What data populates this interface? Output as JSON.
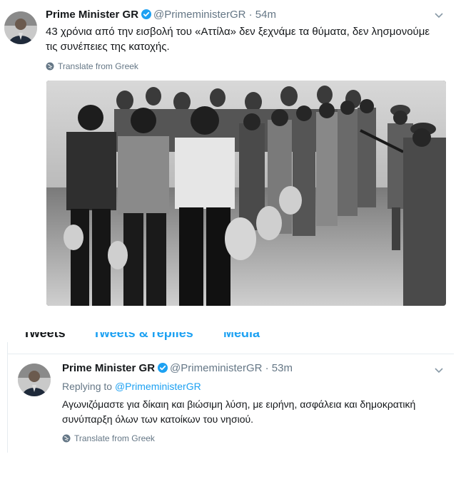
{
  "tweet1": {
    "author_name": "Prime Minister GR",
    "handle": "@PrimeministerGR",
    "separator": "·",
    "time": "54m",
    "text_line1": "43 χρόνια από την εισβολή του «Αττίλα» δεν ξεχνάμε τα θύματα, δεν λησμονούμε",
    "text_line2": "τις συνέπειες της κατοχής.",
    "translate": "Translate from Greek"
  },
  "tabs": {
    "items": [
      "Tweets",
      "Tweets & replies",
      "Media"
    ]
  },
  "tweet2": {
    "author_name": "Prime Minister GR",
    "handle": "@PrimeministerGR",
    "separator": "·",
    "time": "53m",
    "replying_prefix": "Replying to",
    "replying_handle": "@PrimeministerGR",
    "text_line1": "Αγωνιζόμαστε για δίκαιη και βιώσιμη λύση, με ειρήνη, ασφάλεια και δημοκρατική",
    "text_line2": "συνύπαρξη όλων των κατοίκων του νησιού.",
    "translate": "Translate from Greek"
  },
  "icons": {
    "verified": "verified-badge-icon",
    "chevron": "chevron-down-icon",
    "globe": "globe-icon"
  },
  "colors": {
    "link": "#1da1f2",
    "muted": "#657786",
    "verified": "#1da1f2"
  }
}
